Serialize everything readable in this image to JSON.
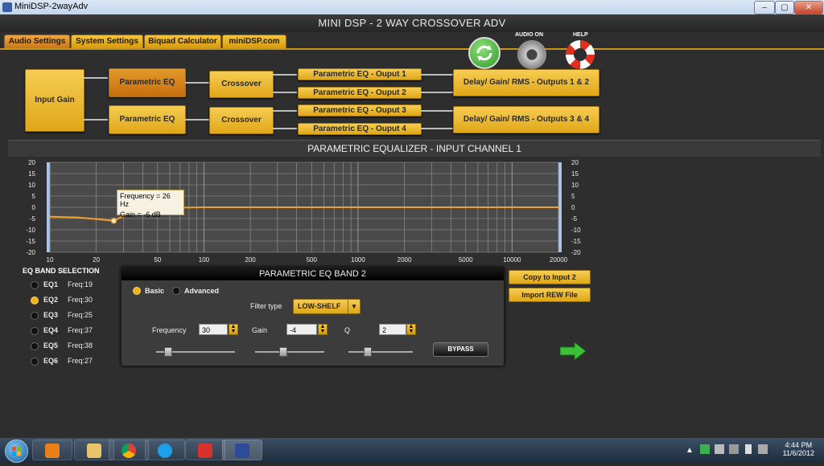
{
  "window": {
    "title": "MiniDSP-2wayAdv",
    "buttons": [
      "–",
      "▢",
      "✕"
    ]
  },
  "app": {
    "title": "MINI DSP - 2 WAY CROSSOVER ADV"
  },
  "tabs": [
    "Audio Settings",
    "System Settings",
    "Biquad Calculator",
    "miniDSP.com"
  ],
  "top_icons": {
    "audio_on": "AUDIO ON",
    "help": "HELP"
  },
  "routing": {
    "input_gain": "Input Gain",
    "peq1": "Parametric EQ",
    "peq2": "Parametric EQ",
    "crossover1": "Crossover",
    "crossover2": "Crossover",
    "out1": "Parametric EQ - Ouput 1",
    "out2": "Parametric EQ - Ouput 2",
    "out3": "Parametric EQ - Ouput 3",
    "out4": "Parametric EQ - Ouput 4",
    "delay12": "Delay/ Gain/ RMS - Outputs 1 & 2",
    "delay34": "Delay/ Gain/ RMS - Outputs 3 & 4"
  },
  "eq_section_title": "PARAMETRIC EQUALIZER - INPUT CHANNEL 1",
  "chart_data": {
    "type": "line",
    "x_scale": "log",
    "xlim": [
      10,
      20000
    ],
    "ylim": [
      -20,
      20
    ],
    "x_ticks": [
      "10",
      "20",
      "50",
      "100",
      "200",
      "500",
      "1000",
      "2000",
      "5000",
      "10000",
      "20000"
    ],
    "y_ticks": [
      "20",
      "15",
      "10",
      "5",
      "0",
      "-5",
      "-10",
      "-15",
      "-20"
    ],
    "series": [
      {
        "x": [
          10,
          15,
          20,
          26,
          35,
          50,
          100,
          1000,
          20000
        ],
        "y": [
          -4.2,
          -4.5,
          -5.2,
          -6,
          -1.5,
          -0.3,
          0,
          0,
          0
        ],
        "color": "#f0a030"
      }
    ],
    "tooltip": {
      "freq": "Frequency = 26 Hz",
      "gain": "Gain = -6 dB"
    },
    "grid": true
  },
  "band_selection": {
    "title": "EQ BAND SELECTION",
    "items": [
      {
        "label": "EQ1",
        "freq": "Freq:19",
        "selected": false
      },
      {
        "label": "EQ2",
        "freq": "Freq:30",
        "selected": true
      },
      {
        "label": "EQ3",
        "freq": "Freq:25",
        "selected": false
      },
      {
        "label": "EQ4",
        "freq": "Freq:37",
        "selected": false
      },
      {
        "label": "EQ5",
        "freq": "Freq:38",
        "selected": false
      },
      {
        "label": "EQ6",
        "freq": "Freq:27",
        "selected": false
      }
    ]
  },
  "band_panel": {
    "title": "PARAMETRIC EQ BAND 2",
    "mode_basic": "Basic",
    "mode_advanced": "Advanced",
    "filter_type_label": "Filter type",
    "filter_type_value": "LOW-SHELF",
    "frequency_label": "Frequency",
    "frequency_value": "30",
    "gain_label": "Gain",
    "gain_value": "-4",
    "q_label": "Q",
    "q_value": "2",
    "bypass": "BYPASS"
  },
  "side_buttons": {
    "copy": "Copy to Input 2",
    "import": "Import REW File"
  },
  "clock": {
    "time": "4:44 PM",
    "date": "11/6/2012"
  }
}
